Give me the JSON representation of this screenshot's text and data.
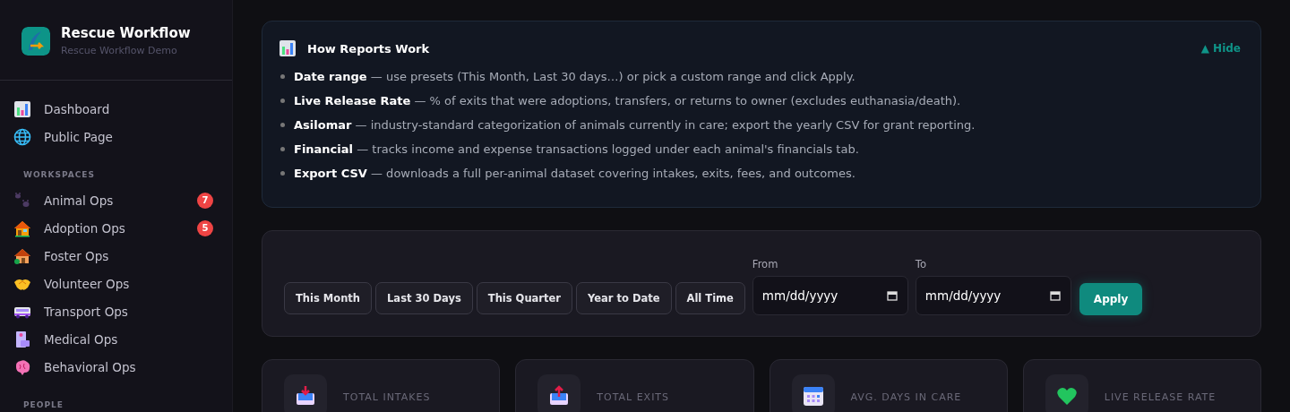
{
  "brand": {
    "title": "Rescue Workflow",
    "subtitle": "Rescue Workflow Demo"
  },
  "sidebar": {
    "top_items": [
      {
        "label": "Dashboard",
        "selected": false
      },
      {
        "label": "Public Page",
        "selected": false
      }
    ],
    "sections": [
      {
        "heading": "WORKSPACES",
        "items": [
          {
            "label": "Animal Ops",
            "badge": "7"
          },
          {
            "label": "Adoption Ops",
            "badge": "5"
          },
          {
            "label": "Foster Ops"
          },
          {
            "label": "Volunteer Ops"
          },
          {
            "label": "Transport Ops"
          },
          {
            "label": "Medical Ops"
          },
          {
            "label": "Behavioral Ops"
          }
        ]
      },
      {
        "heading": "PEOPLE"
      }
    ]
  },
  "info": {
    "title": "How Reports Work",
    "toggle": "▲ Hide",
    "points": [
      "**Date range** — use presets (This Month, Last 30 days…) or pick a custom range and click Apply.",
      "**Live Release Rate** — % of exits that were adoptions, transfers, or returns to owner (excludes euthanasia/death).",
      "**Asilomar** — industry-standard categorization of animals currently in care; export the yearly CSV for grant reporting.",
      "**Financial** — tracks income and expense transactions logged under each animal's financials tab.",
      "**Export CSV** — downloads a full per-animal dataset covering intakes, exits, fees, and outcomes."
    ]
  },
  "filters": {
    "presets": [
      {
        "label": "This Month",
        "selected": false
      },
      {
        "label": "Last 30 Days",
        "selected": false
      },
      {
        "label": "This Quarter",
        "selected": false
      },
      {
        "label": "Year to Date",
        "selected": false
      },
      {
        "label": "All Time",
        "selected": false
      }
    ],
    "from": {
      "label": "From",
      "placeholder": "mm/dd/yyyy"
    },
    "to": {
      "label": "To",
      "placeholder": "mm/dd/yyyy"
    },
    "apply": "Apply"
  },
  "stats": [
    {
      "label": "TOTAL INTAKES"
    },
    {
      "label": "TOTAL EXITS"
    },
    {
      "label": "AVG. DAYS IN CARE"
    },
    {
      "label": "LIVE RELEASE RATE"
    }
  ]
}
